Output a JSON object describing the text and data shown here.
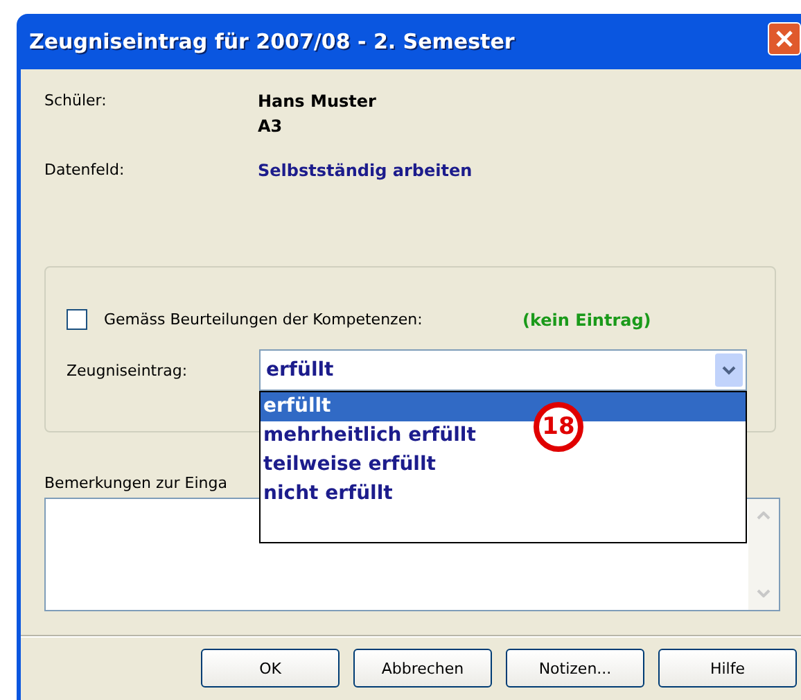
{
  "window": {
    "title": "Zeugniseintrag für 2007/08 - 2. Semester"
  },
  "info": [
    {
      "label": "Schüler:",
      "values": [
        "Hans Muster",
        "A3"
      ],
      "kind": "plain"
    },
    {
      "label": "Datenfeld:",
      "values": [
        "Selbstständig arbeiten"
      ],
      "kind": "link"
    }
  ],
  "group": {
    "checkbox": {
      "label": "Gemäss Beurteilungen der Kompetenzen:",
      "checked": false
    },
    "status": "(kein Eintrag)",
    "combo": {
      "label": "Zeugniseintrag:",
      "value": "erfüllt",
      "expanded": true,
      "options": [
        {
          "label": "erfüllt",
          "selected": true
        },
        {
          "label": "mehrheitlich erfüllt",
          "selected": false
        },
        {
          "label": "teilweise erfüllt",
          "selected": false
        },
        {
          "label": "nicht erfüllt",
          "selected": false
        }
      ]
    }
  },
  "marker": "18",
  "remarks": {
    "label": "Bemerkungen zur Einga"
  },
  "buttons": [
    "OK",
    "Abbrechen",
    "Notizen...",
    "Hilfe"
  ]
}
